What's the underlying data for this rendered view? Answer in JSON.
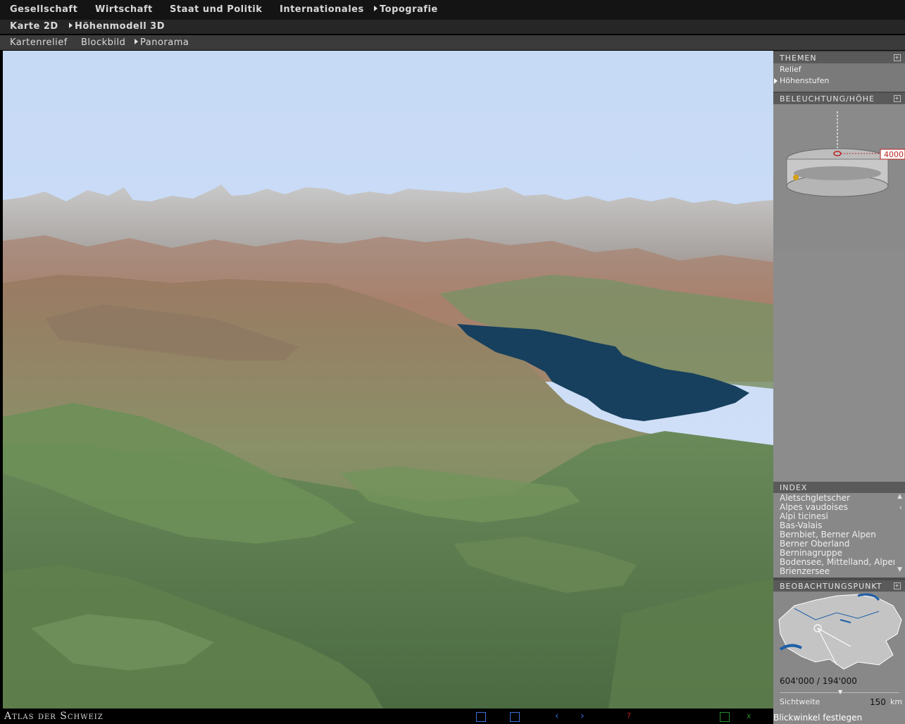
{
  "nav": {
    "top": [
      "Gesellschaft",
      "Wirtschaft",
      "Staat und Politik",
      "Internationales",
      "Topografie"
    ],
    "second": [
      "Karte 2D",
      "Höhenmodell 3D"
    ],
    "third": [
      "Kartenrelief",
      "Blockbild",
      "Panorama"
    ]
  },
  "panels": {
    "themen": {
      "title": "THEMEN",
      "items": [
        "Relief",
        "Höhenstufen"
      ]
    },
    "beleuchtung": {
      "title": "BELEUCHTUNG/HÖHE",
      "height_value": "4000"
    },
    "index": {
      "title": "INDEX",
      "items": [
        "Aletschgletscher",
        "Alpes vaudoises",
        "Alpi ticinesi",
        "Bas-Valais",
        "Bernbiet, Berner Alpen",
        "Berner Oberland",
        "Berninagruppe",
        "Bodensee, Mittelland, Alpen",
        "Brienzersee"
      ]
    },
    "beobachtung": {
      "title": "BEOBACHTUNGSPUNKT",
      "coords": "604'000 / 194'000",
      "sichtweite_label": "Sichtweite",
      "sichtweite_value": "150",
      "sichtweite_unit": "km"
    }
  },
  "footer": {
    "brand": "Atlas der Schweiz",
    "status": "Blickwinkel festlegen"
  },
  "colors": {
    "sky": "#c6d9f5",
    "lake": "#17405e",
    "panel": "#888888",
    "header": "#5a5a5a"
  }
}
